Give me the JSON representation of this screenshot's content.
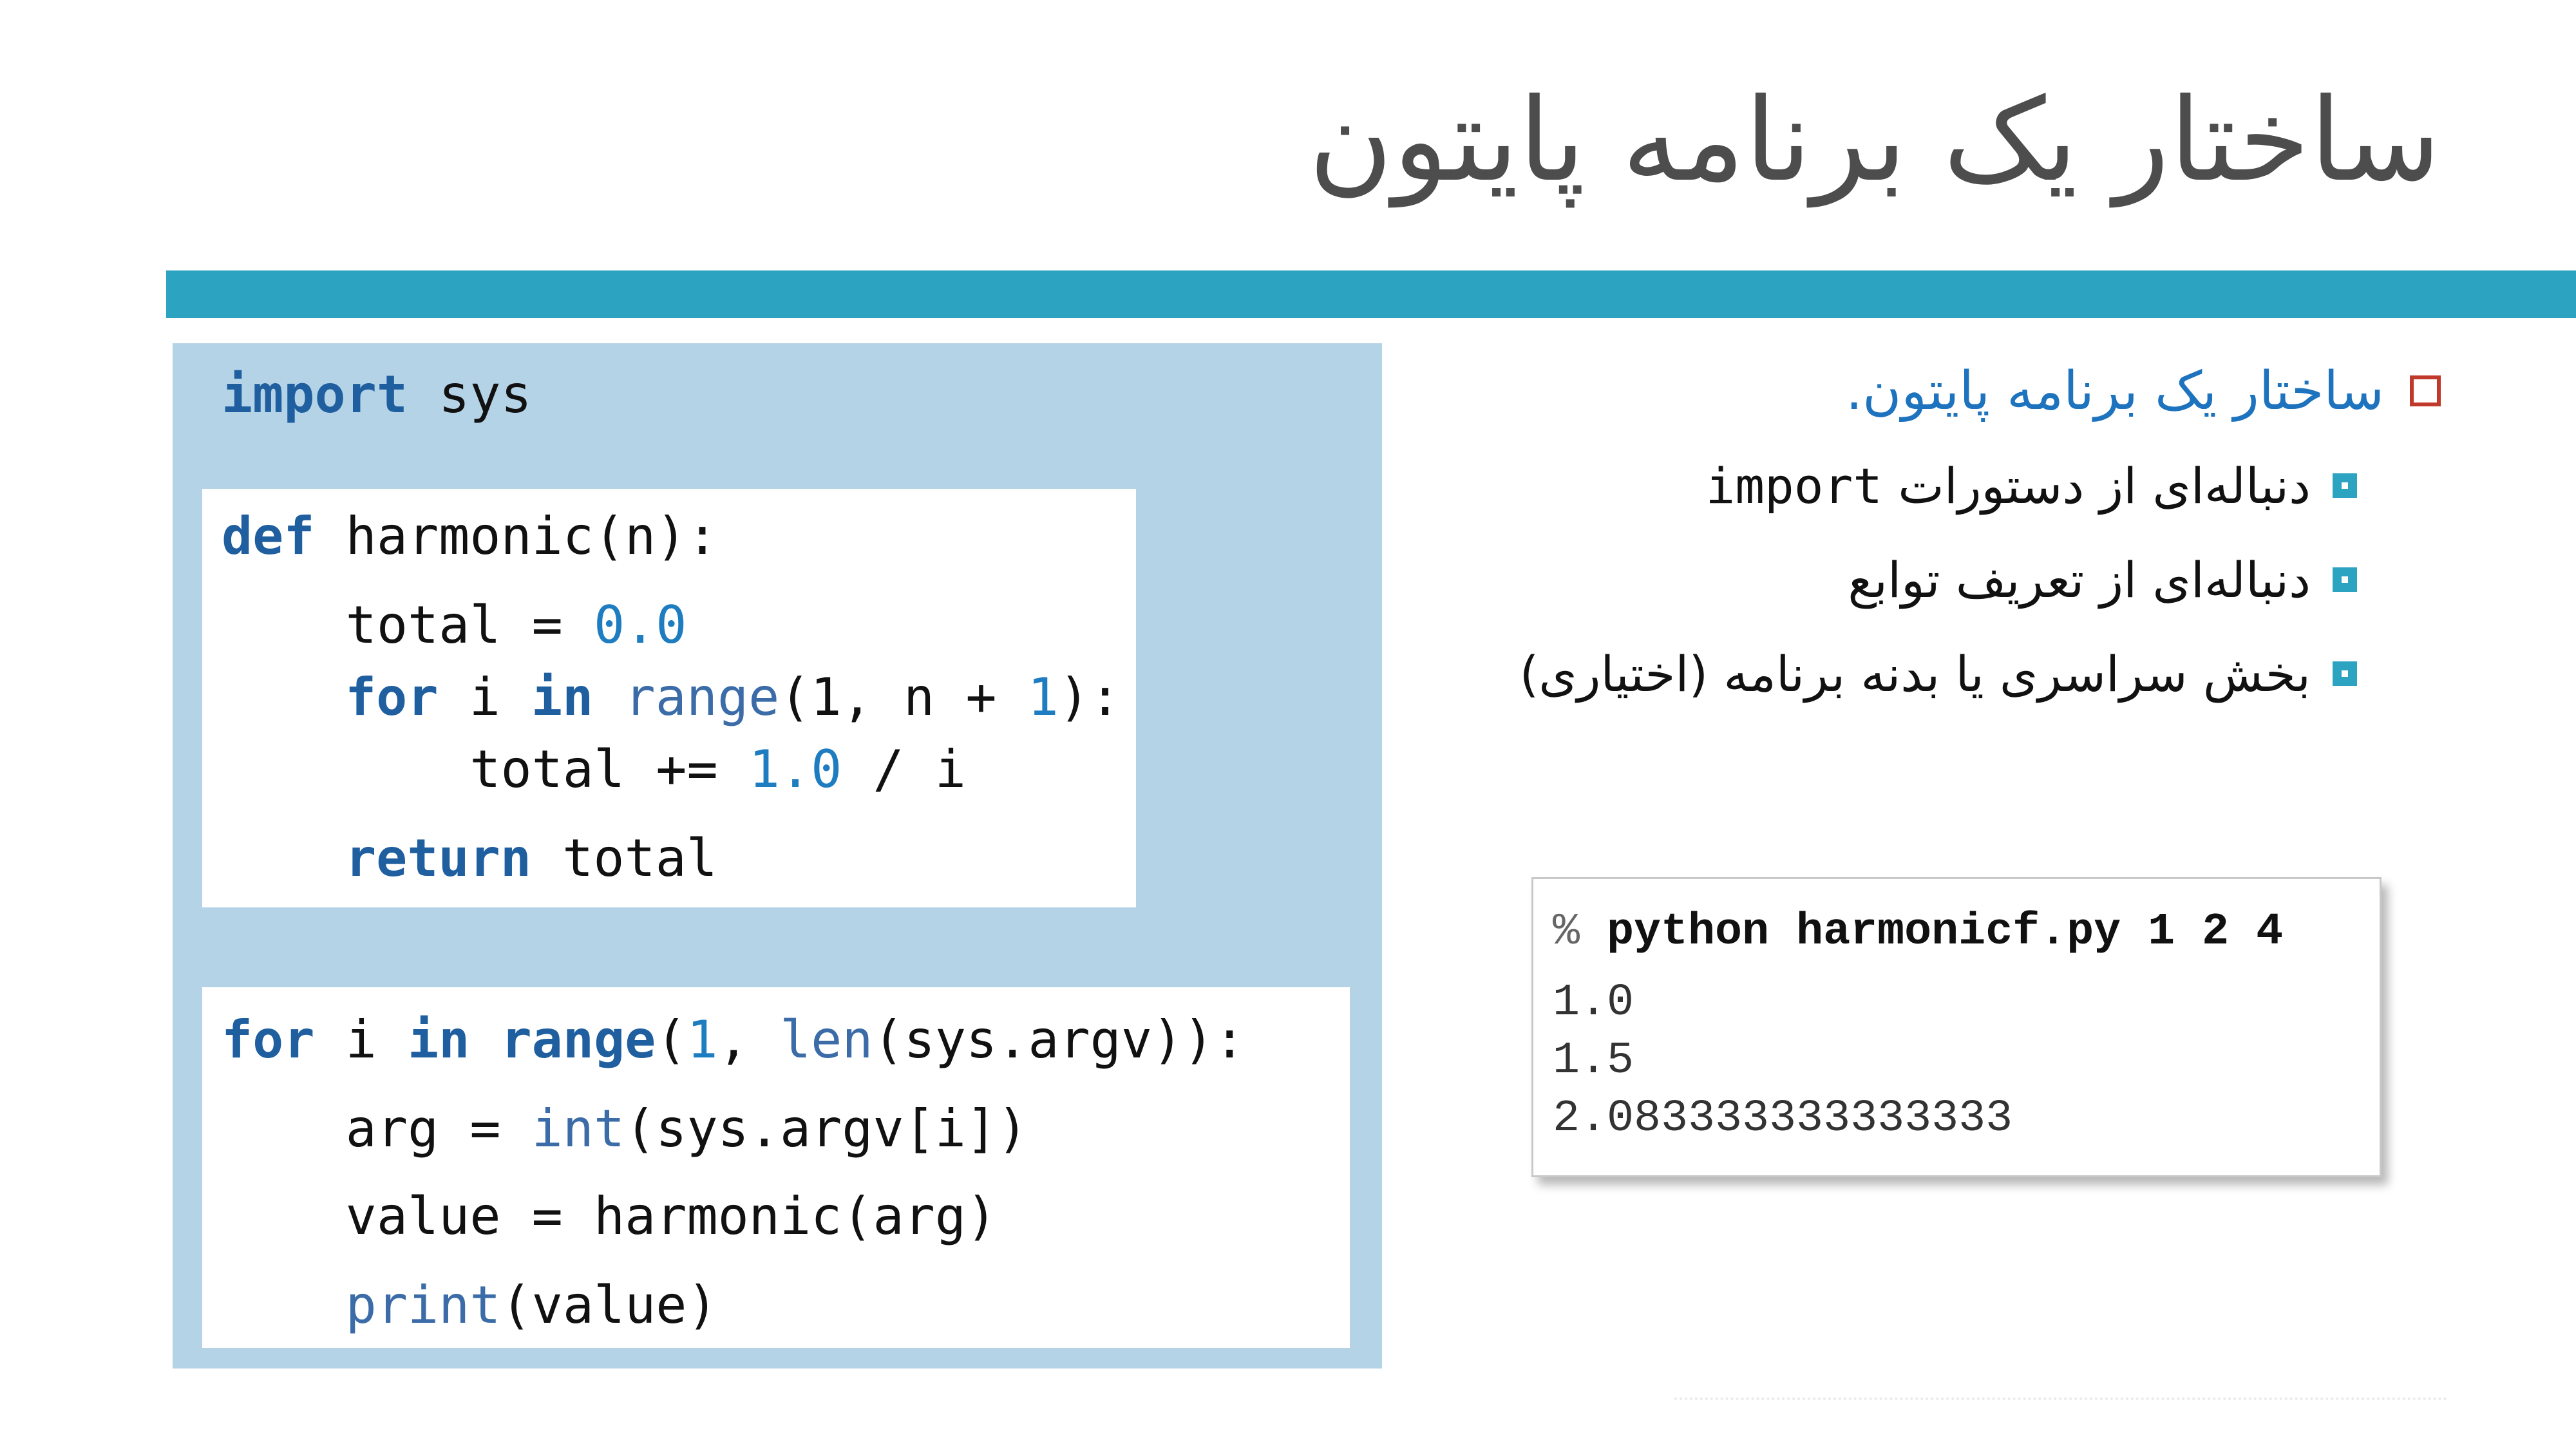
{
  "slide": {
    "title": "ساختار یک برنامه پایتون"
  },
  "bullets": {
    "main": "ساختار یک برنامه پایتون.",
    "sub1_text": "دنباله‌ای از دستورات",
    "sub1_code": "import",
    "sub2": "دنباله‌ای از تعریف توابع",
    "sub3": "بخش سراسری یا بدنه برنامه (اختیاری)"
  },
  "code": {
    "import_kw": "import",
    "import_rest": " sys",
    "def_kw": "def",
    "def_rest": " harmonic(n):",
    "total_init_a": "    total = ",
    "total_init_num": "0.0",
    "for1_kw": "for",
    "for1_a": " i ",
    "for1_in": "in",
    "for1_sp": " ",
    "for1_range": "range",
    "for1_b": "(1, n + ",
    "for1_num": "1",
    "for1_c": "):",
    "accum_a": "        total += ",
    "accum_num": "1.0",
    "accum_b": " / i",
    "return_kw": "return",
    "return_rest": " total",
    "main_for_kw": "for",
    "main_for_a": " i ",
    "main_for_in": "in",
    "main_for_sp": " ",
    "main_for_range": "range",
    "main_for_b": "(",
    "main_for_num": "1",
    "main_for_c": ", ",
    "main_for_len": "len",
    "main_for_d": "(sys.argv)):",
    "arg_a": "    arg = ",
    "arg_int": "int",
    "arg_b": "(sys.argv[i])",
    "value_line": "    value = harmonic(arg)",
    "print_a": "    ",
    "print_fn": "print",
    "print_b": "(value)"
  },
  "terminal": {
    "prompt": "% ",
    "command": "python harmonicf.py 1 2 4",
    "outputs": [
      "1.0",
      "1.5",
      "2.083333333333333"
    ]
  },
  "colors": {
    "accent_bar": "#2ba3c1",
    "code_panel": "#b5d3e7",
    "keyword": "#1f5f9f",
    "number": "#1e7cc0",
    "bullet_main_text": "#1e73be",
    "bullet_main_marker": "#c0392b"
  },
  "icons": {
    "main_marker": "hollow-square-icon",
    "sub_marker": "filled-square-icon"
  }
}
